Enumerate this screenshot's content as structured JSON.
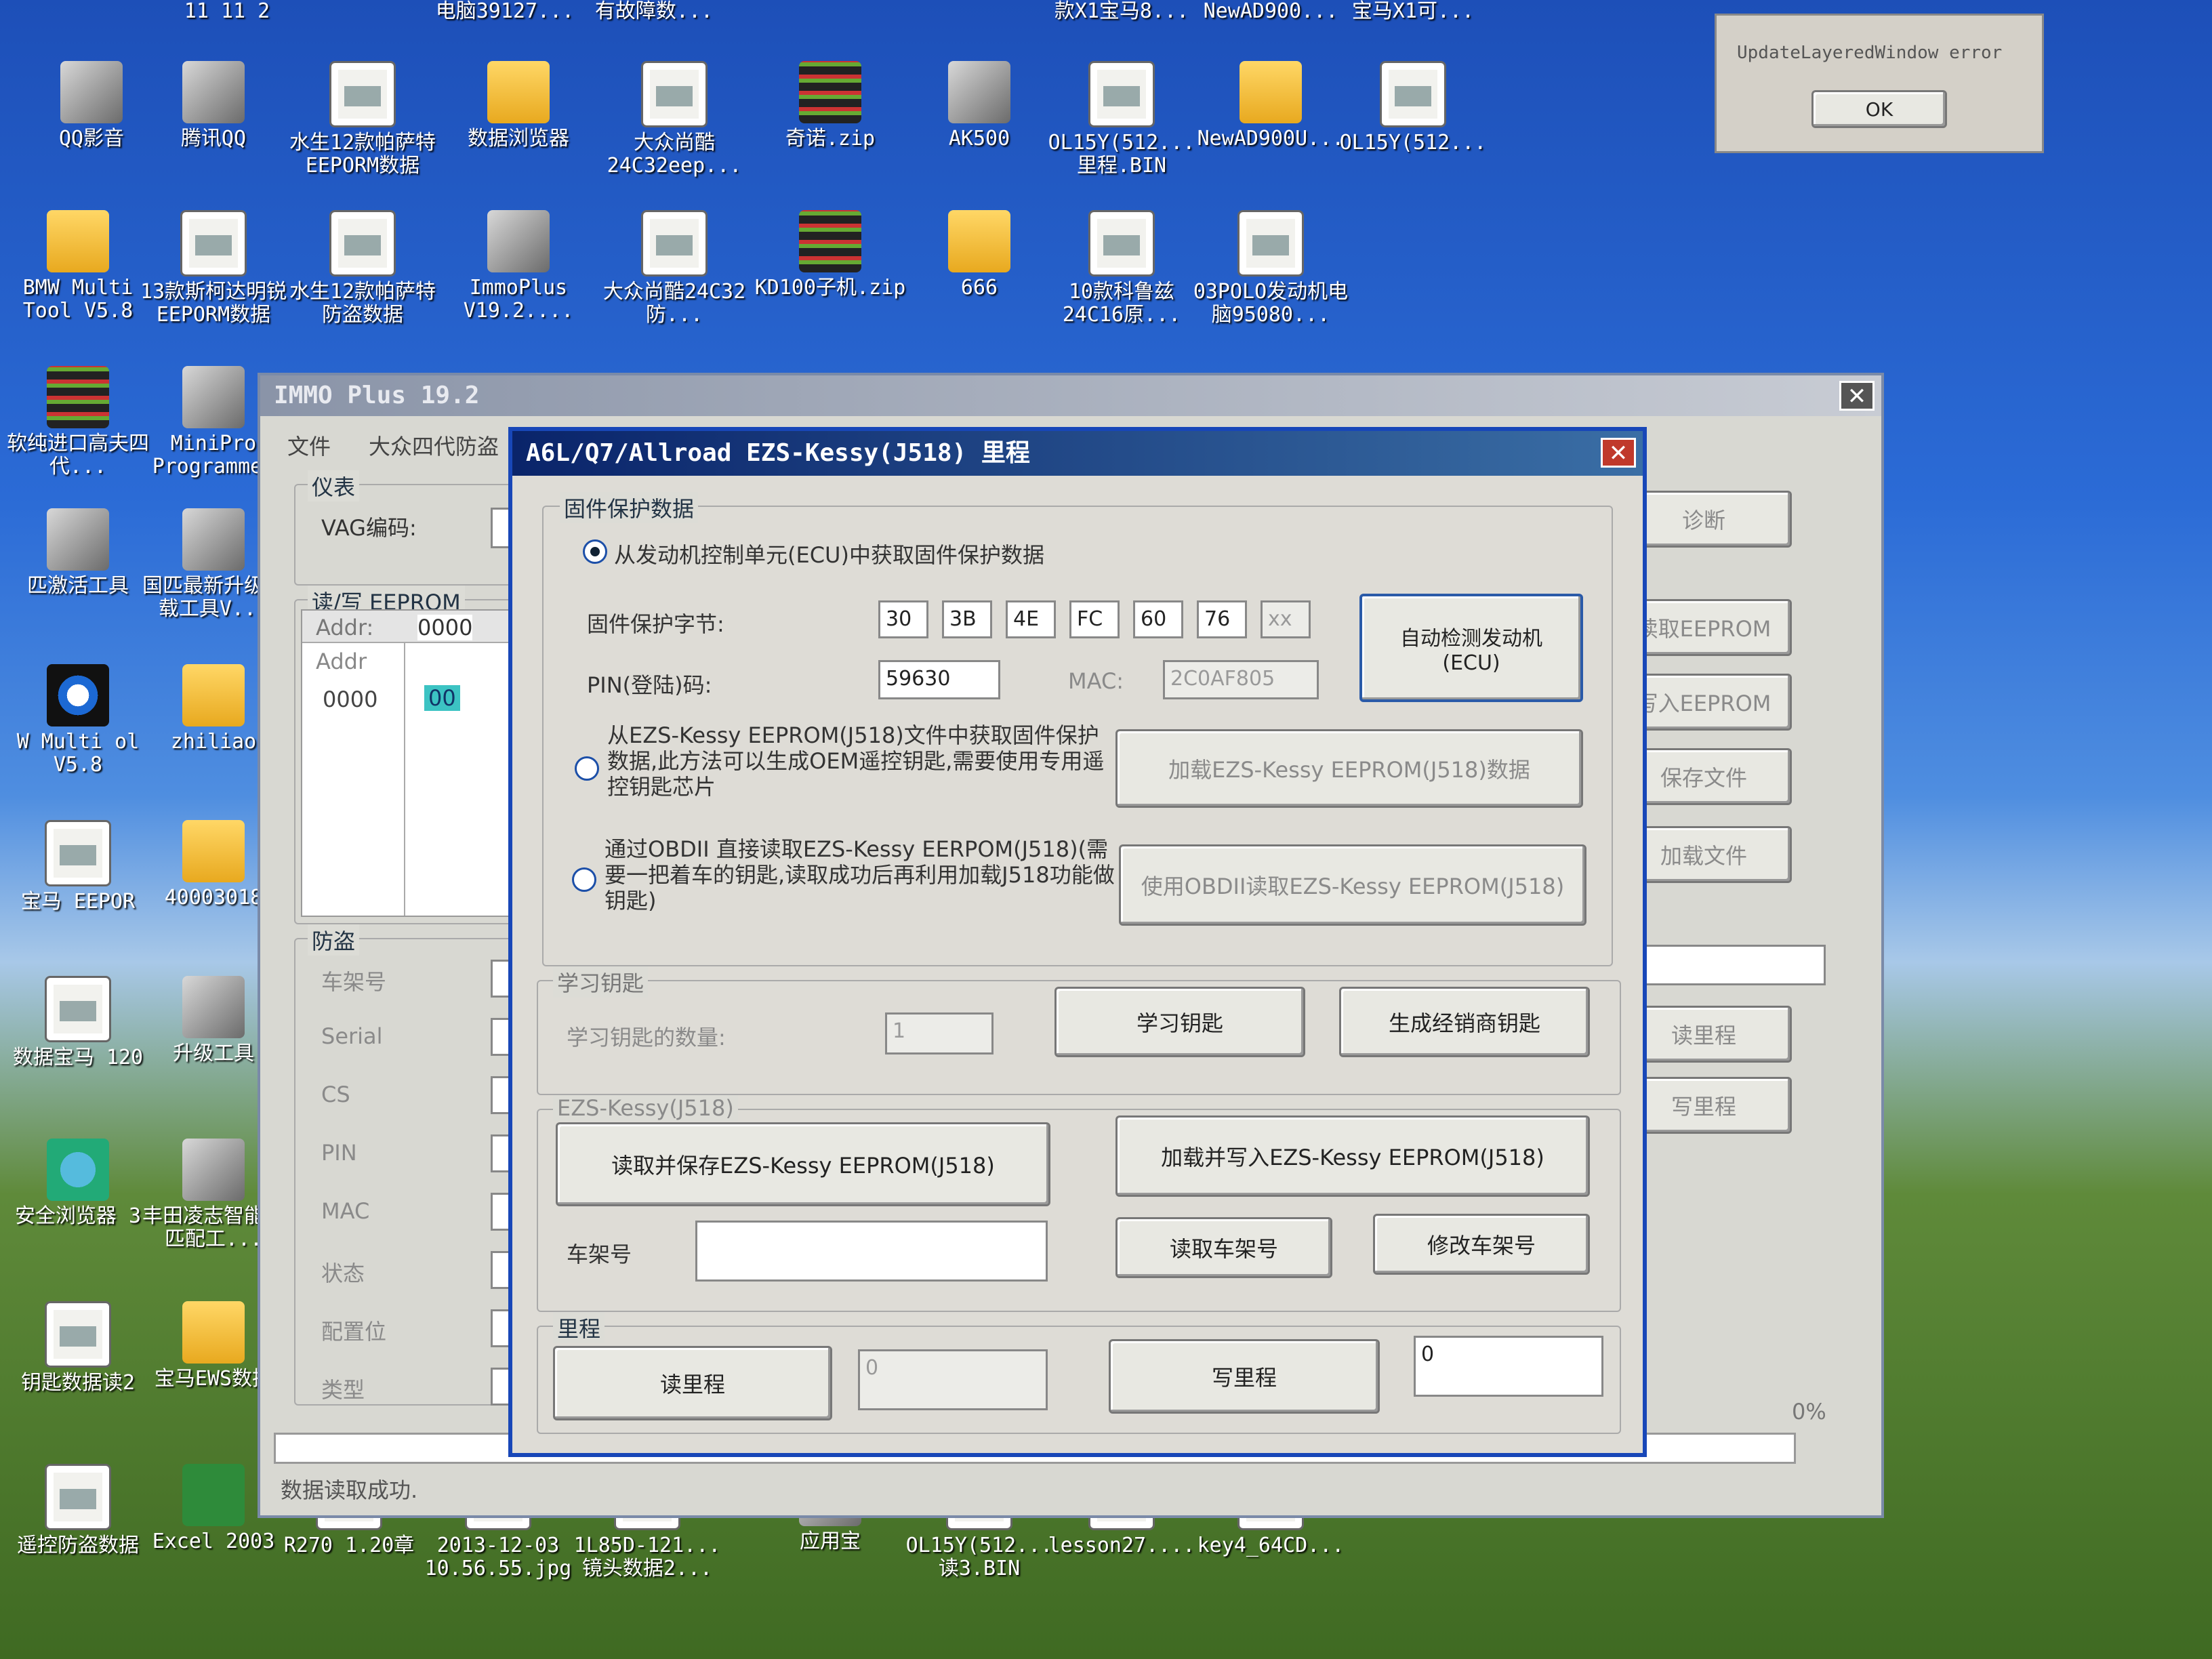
{
  "desktop": {
    "top_row_labels": [
      "11 11 2",
      "电脑39127...",
      "有故障数...",
      "款X1宝马8...",
      "NewAD900...",
      "宝马X1可..."
    ],
    "icons": [
      {
        "label": "QQ影音",
        "icon": "app-icon"
      },
      {
        "label": "腾讯QQ",
        "icon": "app-icon"
      },
      {
        "label": "水生12款帕萨特EEPORM数据",
        "icon": "document-icon"
      },
      {
        "label": "数据浏览器",
        "icon": "folder-icon"
      },
      {
        "label": "大众尚酷24C32eep...",
        "icon": "document-icon"
      },
      {
        "label": "奇诺.zip",
        "icon": "zip-icon"
      },
      {
        "label": "AK500",
        "icon": "app-icon"
      },
      {
        "label": "OL15Y(512...里程.BIN",
        "icon": "document-icon"
      },
      {
        "label": "NewAD900U...",
        "icon": "folder-icon"
      },
      {
        "label": "OL15Y(512...",
        "icon": "document-icon"
      },
      {
        "label": "BMW Multi Tool V5.8",
        "icon": "folder-icon"
      },
      {
        "label": "13款斯柯达明锐EEPORM数据",
        "icon": "document-icon"
      },
      {
        "label": "水生12款帕萨特防盗数据",
        "icon": "document-icon"
      },
      {
        "label": "ImmoPlus V19.2....",
        "icon": "app-icon"
      },
      {
        "label": "大众尚酷24C32防...",
        "icon": "document-icon"
      },
      {
        "label": "KD100子机.zip",
        "icon": "zip-icon"
      },
      {
        "label": "666",
        "icon": "folder-icon"
      },
      {
        "label": "10款科鲁兹24C16原...",
        "icon": "document-icon"
      },
      {
        "label": "03POLO发动机电脑95080...",
        "icon": "document-icon"
      },
      {
        "label": "软纯进口高夫四代...",
        "icon": "zip-icon"
      },
      {
        "label": "MiniPro Programmer",
        "icon": "app-icon"
      },
      {
        "label": "匹激活工具",
        "icon": "app-icon"
      },
      {
        "label": "国匹最新升级下载工具V...",
        "icon": "app-icon"
      },
      {
        "label": "W Multi ol V5.8",
        "icon": "bmw-icon"
      },
      {
        "label": "zhiliao",
        "icon": "folder-icon"
      },
      {
        "label": "宝马 EEPOR",
        "icon": "document-icon"
      },
      {
        "label": "40003018",
        "icon": "folder-icon"
      },
      {
        "label": "数据宝马 120",
        "icon": "document-icon"
      },
      {
        "label": "升级工具",
        "icon": "app-icon"
      },
      {
        "label": "安全浏览器 3",
        "icon": "ie-icon"
      },
      {
        "label": "丰田凌志智能卡匹配工...",
        "icon": "app-icon"
      },
      {
        "label": "钥匙数据读2",
        "icon": "document-icon"
      },
      {
        "label": "宝马EWS数据",
        "icon": "folder-icon"
      },
      {
        "label": "遥控防盗数据",
        "icon": "document-icon"
      },
      {
        "label": "Excel 2003",
        "icon": "excel-icon"
      },
      {
        "label": "R270 1.20章",
        "icon": "document-icon"
      },
      {
        "label": "2013-12-03 10.56.55.jpg",
        "icon": "document-icon"
      },
      {
        "label": "1L85D-121...镜头数据2...",
        "icon": "document-icon"
      },
      {
        "label": "应用宝",
        "icon": "app-icon"
      },
      {
        "label": "OL15Y(512...读3.BIN",
        "icon": "document-icon"
      },
      {
        "label": "lesson27....",
        "icon": "document-icon"
      },
      {
        "label": "key4_64CD...",
        "icon": "document-icon"
      }
    ]
  },
  "error_box": {
    "message": "UpdateLayeredWindow error",
    "ok": "OK"
  },
  "immo": {
    "title": "IMMO Plus 19.2",
    "close": "✕",
    "menu": [
      "文件",
      "大众四代防盗"
    ],
    "cluster_legend": "仪表",
    "vag_label": "VAG编码:",
    "eeprom_legend": "读/写 EEPROM",
    "addr_label": "Addr:",
    "addr_value": "0000",
    "col_addr": "Addr",
    "row_addr": "0000",
    "row_value": "00",
    "immo_legend": "防盗",
    "fields": [
      "车架号",
      "Serial",
      "CS",
      "PIN",
      "MAC",
      "状态",
      "配置位",
      "类型"
    ],
    "right_buttons": [
      "诊断",
      "读取EEPROM",
      "写入EEPROM",
      "保存文件",
      "加载文件",
      "读里程",
      "写里程"
    ],
    "progress": "0%",
    "progress_value": 0,
    "status": "数据读取成功."
  },
  "dialog": {
    "title": "A6L/Q7/Allroad EZS-Kessy(J518) 里程",
    "close": "✕",
    "fw_legend": "固件保护数据",
    "opt1": "从发动机控制单元(ECU)中获取固件保护数据",
    "fw_bytes_label": "固件保护字节:",
    "fw_bytes": [
      "30",
      "3B",
      "4E",
      "FC",
      "60",
      "76",
      "xx"
    ],
    "pin_label": "PIN(登陆)码:",
    "pin_value": "59630",
    "mac_label": "MAC:",
    "mac_value": "2C0AF805",
    "auto_detect": "自动检测发动机(ECU)",
    "opt2": "从EZS-Kessy EEPROM(J518)文件中获取固件保护数据,此方法可以生成OEM遥控钥匙,需要使用专用遥控钥匙芯片",
    "opt2_btn": "加载EZS-Kessy EEPROM(J518)数据",
    "opt3": "通过OBDII 直接读取EZS-Kessy EERPOM(J518)(需要一把着车的钥匙,读取成功后再利用加载J518功能做钥匙)",
    "opt3_btn": "使用OBDII读取EZS-Kessy EEPROM(J518)",
    "learn_legend": "学习钥匙",
    "learn_count_label": "学习钥匙的数量:",
    "learn_count": "1",
    "learn_btn": "学习钥匙",
    "dealer_btn": "生成经销商钥匙",
    "ezs_legend": "EZS-Kessy(J518)",
    "read_save_btn": "读取并保存EZS-Kessy EEPROM(J518)",
    "load_write_btn": "加载并写入EZS-Kessy EEPROM(J518)",
    "vin_label": "车架号",
    "vin_value": "",
    "read_vin_btn": "读取车架号",
    "edit_vin_btn": "修改车架号",
    "mileage_legend": "里程",
    "read_mileage_btn": "读里程",
    "read_mileage_value": "0",
    "write_mileage_btn": "写里程",
    "write_mileage_value": "0"
  }
}
